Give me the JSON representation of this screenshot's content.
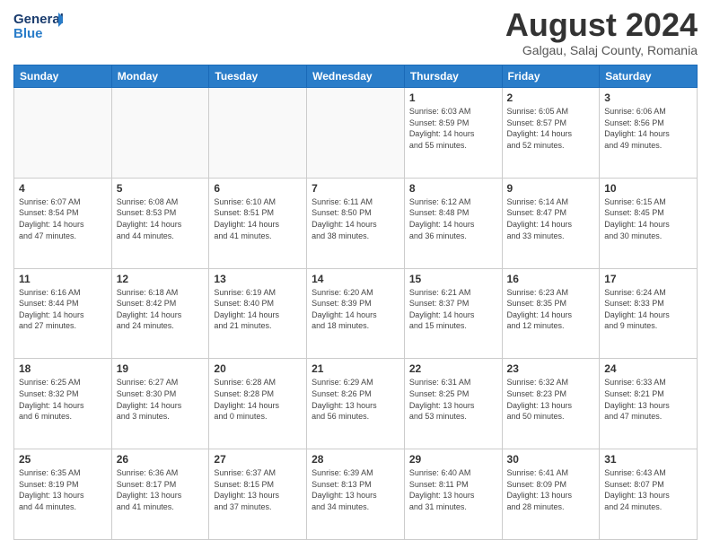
{
  "header": {
    "logo_line1": "General",
    "logo_line2": "Blue",
    "month": "August 2024",
    "location": "Galgau, Salaj County, Romania"
  },
  "days_of_week": [
    "Sunday",
    "Monday",
    "Tuesday",
    "Wednesday",
    "Thursday",
    "Friday",
    "Saturday"
  ],
  "weeks": [
    [
      {
        "day": null,
        "info": null
      },
      {
        "day": null,
        "info": null
      },
      {
        "day": null,
        "info": null
      },
      {
        "day": null,
        "info": null
      },
      {
        "day": "1",
        "info": "Sunrise: 6:03 AM\nSunset: 8:59 PM\nDaylight: 14 hours\nand 55 minutes."
      },
      {
        "day": "2",
        "info": "Sunrise: 6:05 AM\nSunset: 8:57 PM\nDaylight: 14 hours\nand 52 minutes."
      },
      {
        "day": "3",
        "info": "Sunrise: 6:06 AM\nSunset: 8:56 PM\nDaylight: 14 hours\nand 49 minutes."
      }
    ],
    [
      {
        "day": "4",
        "info": "Sunrise: 6:07 AM\nSunset: 8:54 PM\nDaylight: 14 hours\nand 47 minutes."
      },
      {
        "day": "5",
        "info": "Sunrise: 6:08 AM\nSunset: 8:53 PM\nDaylight: 14 hours\nand 44 minutes."
      },
      {
        "day": "6",
        "info": "Sunrise: 6:10 AM\nSunset: 8:51 PM\nDaylight: 14 hours\nand 41 minutes."
      },
      {
        "day": "7",
        "info": "Sunrise: 6:11 AM\nSunset: 8:50 PM\nDaylight: 14 hours\nand 38 minutes."
      },
      {
        "day": "8",
        "info": "Sunrise: 6:12 AM\nSunset: 8:48 PM\nDaylight: 14 hours\nand 36 minutes."
      },
      {
        "day": "9",
        "info": "Sunrise: 6:14 AM\nSunset: 8:47 PM\nDaylight: 14 hours\nand 33 minutes."
      },
      {
        "day": "10",
        "info": "Sunrise: 6:15 AM\nSunset: 8:45 PM\nDaylight: 14 hours\nand 30 minutes."
      }
    ],
    [
      {
        "day": "11",
        "info": "Sunrise: 6:16 AM\nSunset: 8:44 PM\nDaylight: 14 hours\nand 27 minutes."
      },
      {
        "day": "12",
        "info": "Sunrise: 6:18 AM\nSunset: 8:42 PM\nDaylight: 14 hours\nand 24 minutes."
      },
      {
        "day": "13",
        "info": "Sunrise: 6:19 AM\nSunset: 8:40 PM\nDaylight: 14 hours\nand 21 minutes."
      },
      {
        "day": "14",
        "info": "Sunrise: 6:20 AM\nSunset: 8:39 PM\nDaylight: 14 hours\nand 18 minutes."
      },
      {
        "day": "15",
        "info": "Sunrise: 6:21 AM\nSunset: 8:37 PM\nDaylight: 14 hours\nand 15 minutes."
      },
      {
        "day": "16",
        "info": "Sunrise: 6:23 AM\nSunset: 8:35 PM\nDaylight: 14 hours\nand 12 minutes."
      },
      {
        "day": "17",
        "info": "Sunrise: 6:24 AM\nSunset: 8:33 PM\nDaylight: 14 hours\nand 9 minutes."
      }
    ],
    [
      {
        "day": "18",
        "info": "Sunrise: 6:25 AM\nSunset: 8:32 PM\nDaylight: 14 hours\nand 6 minutes."
      },
      {
        "day": "19",
        "info": "Sunrise: 6:27 AM\nSunset: 8:30 PM\nDaylight: 14 hours\nand 3 minutes."
      },
      {
        "day": "20",
        "info": "Sunrise: 6:28 AM\nSunset: 8:28 PM\nDaylight: 14 hours\nand 0 minutes."
      },
      {
        "day": "21",
        "info": "Sunrise: 6:29 AM\nSunset: 8:26 PM\nDaylight: 13 hours\nand 56 minutes."
      },
      {
        "day": "22",
        "info": "Sunrise: 6:31 AM\nSunset: 8:25 PM\nDaylight: 13 hours\nand 53 minutes."
      },
      {
        "day": "23",
        "info": "Sunrise: 6:32 AM\nSunset: 8:23 PM\nDaylight: 13 hours\nand 50 minutes."
      },
      {
        "day": "24",
        "info": "Sunrise: 6:33 AM\nSunset: 8:21 PM\nDaylight: 13 hours\nand 47 minutes."
      }
    ],
    [
      {
        "day": "25",
        "info": "Sunrise: 6:35 AM\nSunset: 8:19 PM\nDaylight: 13 hours\nand 44 minutes."
      },
      {
        "day": "26",
        "info": "Sunrise: 6:36 AM\nSunset: 8:17 PM\nDaylight: 13 hours\nand 41 minutes."
      },
      {
        "day": "27",
        "info": "Sunrise: 6:37 AM\nSunset: 8:15 PM\nDaylight: 13 hours\nand 37 minutes."
      },
      {
        "day": "28",
        "info": "Sunrise: 6:39 AM\nSunset: 8:13 PM\nDaylight: 13 hours\nand 34 minutes."
      },
      {
        "day": "29",
        "info": "Sunrise: 6:40 AM\nSunset: 8:11 PM\nDaylight: 13 hours\nand 31 minutes."
      },
      {
        "day": "30",
        "info": "Sunrise: 6:41 AM\nSunset: 8:09 PM\nDaylight: 13 hours\nand 28 minutes."
      },
      {
        "day": "31",
        "info": "Sunrise: 6:43 AM\nSunset: 8:07 PM\nDaylight: 13 hours\nand 24 minutes."
      }
    ]
  ]
}
